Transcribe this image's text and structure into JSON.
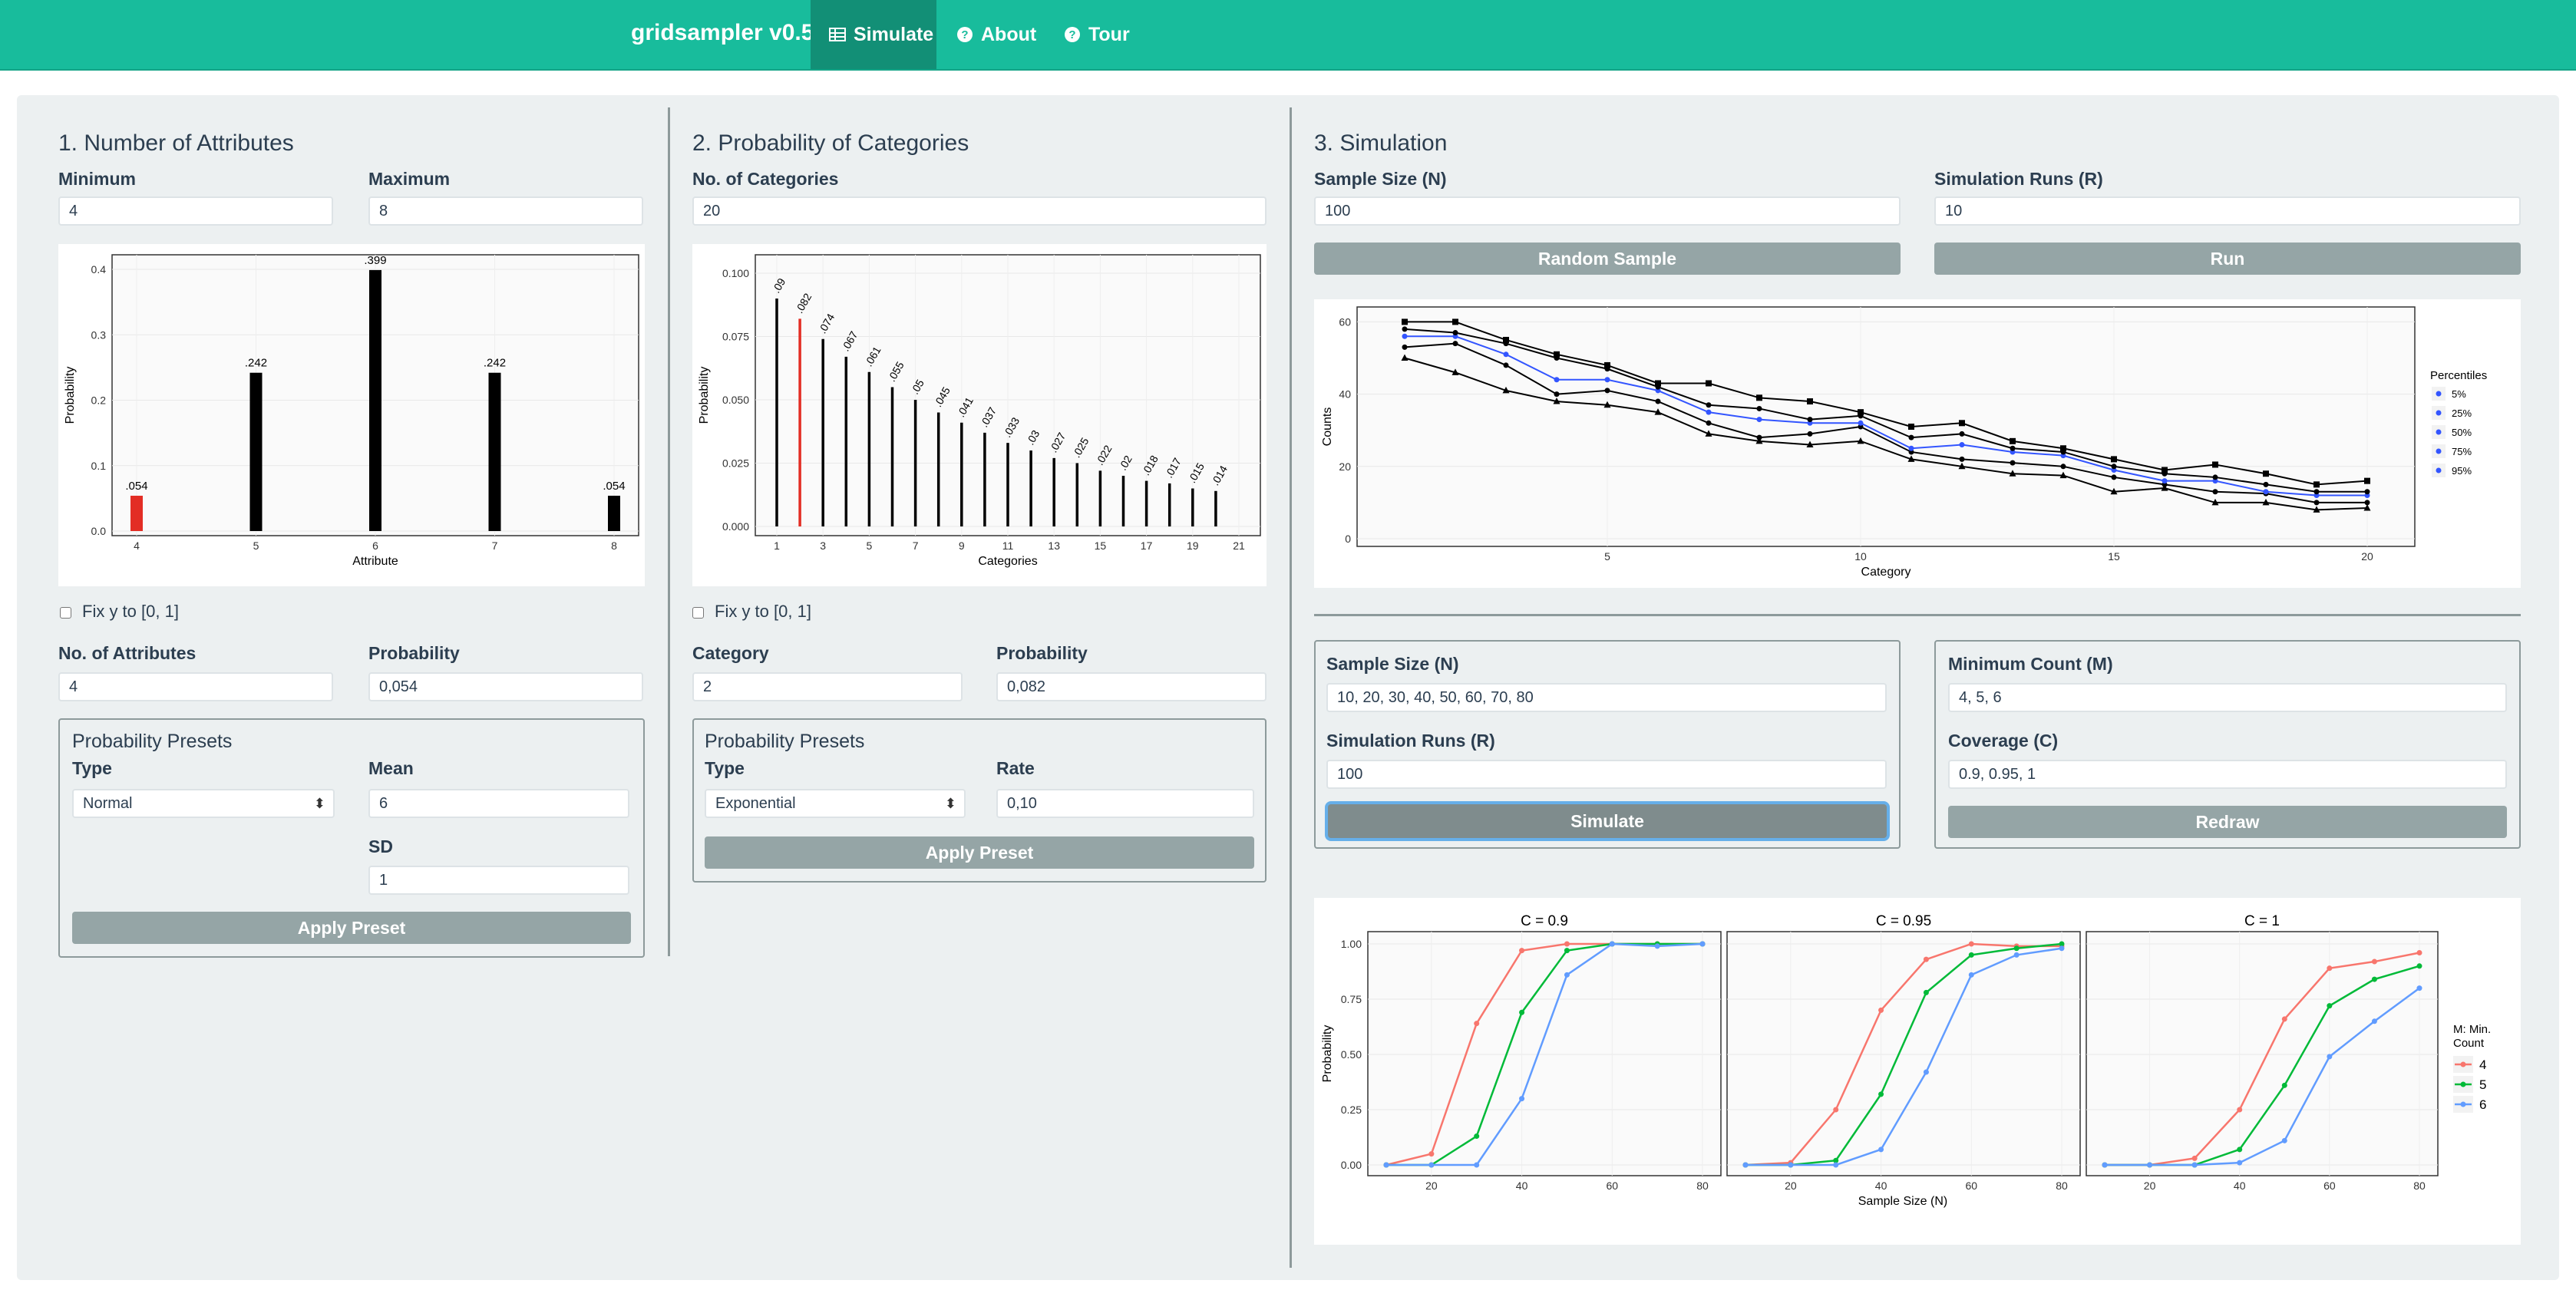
{
  "app": {
    "brand": "gridsampler v0.5",
    "nav": [
      {
        "label": "Simulate",
        "icon": "table-icon",
        "active": true
      },
      {
        "label": "About",
        "icon": "question-circle-icon"
      },
      {
        "label": "Tour",
        "icon": "question-circle-icon"
      }
    ]
  },
  "attributes": {
    "heading": "1. Number of Attributes",
    "min_label": "Minimum",
    "min_value": "4",
    "max_label": "Maximum",
    "max_value": "8",
    "fix_label": "Fix y to [0, 1]",
    "n_label": "No. of Attributes",
    "n_value": "4",
    "p_label": "Probability",
    "p_value": "0,054",
    "presets": {
      "title": "Probability Presets",
      "type_label": "Type",
      "type_value": "Normal",
      "mean_label": "Mean",
      "mean_value": "6",
      "sd_label": "SD",
      "sd_value": "1",
      "apply_label": "Apply Preset"
    }
  },
  "categories": {
    "heading": "2. Probability of Categories",
    "n_label": "No. of Categories",
    "n_value": "20",
    "fix_label": "Fix y to [0, 1]",
    "cat_label": "Category",
    "cat_value": "2",
    "p_label": "Probability",
    "p_value": "0,082",
    "presets": {
      "title": "Probability Presets",
      "type_label": "Type",
      "type_value": "Exponential",
      "rate_label": "Rate",
      "rate_value": "0,10",
      "apply_label": "Apply Preset"
    }
  },
  "simulation": {
    "heading": "3. Simulation",
    "n_label": "Sample Size (N)",
    "n_value": "100",
    "r_label": "Simulation Runs (R)",
    "r_value": "10",
    "random_label": "Random Sample",
    "run_label": "Run",
    "grid": {
      "n_label": "Sample Size (N)",
      "n_value": "10, 20, 30, 40, 50, 60, 70, 80",
      "r_label": "Simulation Runs (R)",
      "r_value": "100",
      "simulate_label": "Simulate",
      "m_label": "Minimum Count (M)",
      "m_value": "4, 5, 6",
      "c_label": "Coverage (C)",
      "c_value": "0.9, 0.95, 1",
      "redraw_label": "Redraw"
    }
  },
  "colors": {
    "navbar": "#18bc9c",
    "highlight_bar": "#e32d24",
    "bar": "#000000",
    "m4": "#f8766d",
    "m5": "#00ba38",
    "m6": "#619cff",
    "median_line": "#3355ff"
  },
  "chart_data": [
    {
      "type": "bar",
      "xlabel": "Attribute",
      "ylabel": "Probability",
      "categories": [
        "4",
        "5",
        "6",
        "7",
        "8"
      ],
      "values": [
        0.054,
        0.242,
        0.399,
        0.242,
        0.054
      ],
      "data_labels": [
        ".054",
        ".242",
        ".399",
        ".242",
        ".054"
      ],
      "highlight_index": 0,
      "ylim": [
        0,
        0.42
      ],
      "yticks": [
        "0.0",
        "0.1",
        "0.2",
        "0.3",
        "0.4"
      ]
    },
    {
      "type": "bar",
      "xlabel": "Categories",
      "ylabel": "Probability",
      "categories": [
        "1",
        "2",
        "3",
        "4",
        "5",
        "6",
        "7",
        "8",
        "9",
        "10",
        "11",
        "12",
        "13",
        "14",
        "15",
        "16",
        "17",
        "18",
        "19",
        "20"
      ],
      "values": [
        0.09,
        0.082,
        0.074,
        0.067,
        0.061,
        0.055,
        0.05,
        0.045,
        0.041,
        0.037,
        0.033,
        0.03,
        0.027,
        0.025,
        0.022,
        0.02,
        0.018,
        0.017,
        0.015,
        0.014
      ],
      "data_labels": [
        ".09",
        ".082",
        ".074",
        ".067",
        ".061",
        ".055",
        ".05",
        ".045",
        ".041",
        ".037",
        ".033",
        ".03",
        ".027",
        ".025",
        ".022",
        ".02",
        ".018",
        ".017",
        ".015",
        ".014"
      ],
      "highlight_index": 1,
      "xticks": [
        "1",
        "3",
        "5",
        "7",
        "9",
        "11",
        "13",
        "15",
        "17",
        "19",
        "21"
      ],
      "yticks": [
        "0.000",
        "0.025",
        "0.050",
        "0.075",
        "0.100"
      ],
      "ylim": [
        0,
        0.1
      ]
    },
    {
      "type": "line",
      "xlabel": "Category",
      "ylabel": "Counts",
      "legend_title": "Percentiles",
      "x": [
        1,
        2,
        3,
        4,
        5,
        6,
        7,
        8,
        9,
        10,
        11,
        12,
        13,
        14,
        15,
        16,
        17,
        18,
        19,
        20
      ],
      "xticks": [
        "5",
        "10",
        "15",
        "20"
      ],
      "yticks": [
        "0",
        "20",
        "40",
        "60"
      ],
      "ylim": [
        0,
        62
      ],
      "series": [
        {
          "name": "5%",
          "values": [
            50,
            46,
            41,
            38,
            37,
            35,
            29,
            27,
            26,
            27,
            22,
            20,
            18,
            17.5,
            13,
            14,
            10,
            10,
            8,
            8.5
          ]
        },
        {
          "name": "25%",
          "values": [
            53,
            54,
            48,
            40,
            41,
            38,
            32,
            28,
            29,
            31,
            24,
            22,
            21,
            20,
            17,
            15,
            13,
            12.5,
            10,
            10
          ]
        },
        {
          "name": "50%",
          "values": [
            56,
            56,
            51,
            44,
            44,
            41,
            35,
            33,
            32,
            32,
            25,
            26,
            24,
            23,
            19,
            16,
            16,
            13,
            12,
            12
          ]
        },
        {
          "name": "75%",
          "values": [
            58,
            57,
            54,
            50,
            47,
            42,
            37,
            36,
            33,
            34,
            28,
            29,
            25,
            24,
            20,
            18,
            17,
            15,
            13,
            13
          ]
        },
        {
          "name": "95%",
          "values": [
            60,
            60,
            55,
            51,
            48,
            43,
            43,
            39,
            38,
            35,
            31,
            32,
            27,
            25,
            22,
            19,
            20.5,
            18,
            15,
            16
          ]
        }
      ]
    },
    {
      "type": "line",
      "xlabel": "Sample Size (N)",
      "ylabel": "Probability",
      "legend_title": "M: Min.\nCount",
      "x": [
        10,
        20,
        30,
        40,
        50,
        60,
        70,
        80
      ],
      "xticks": [
        "20",
        "40",
        "60",
        "80"
      ],
      "yticks": [
        "0.00",
        "0.25",
        "0.50",
        "0.75",
        "1.00"
      ],
      "ylim": [
        0,
        1
      ],
      "panels": [
        {
          "title": "C = 0.9",
          "series": [
            {
              "name": "4",
              "values": [
                0.0,
                0.05,
                0.64,
                0.97,
                1.0,
                1.0,
                1.0,
                1.0
              ]
            },
            {
              "name": "5",
              "values": [
                0.0,
                0.0,
                0.13,
                0.69,
                0.97,
                1.0,
                1.0,
                1.0
              ]
            },
            {
              "name": "6",
              "values": [
                0.0,
                0.0,
                0.0,
                0.3,
                0.86,
                1.0,
                0.99,
                1.0
              ]
            }
          ]
        },
        {
          "title": "C = 0.95",
          "series": [
            {
              "name": "4",
              "values": [
                0.0,
                0.01,
                0.25,
                0.7,
                0.93,
                1.0,
                0.99,
                0.99
              ]
            },
            {
              "name": "5",
              "values": [
                0.0,
                0.0,
                0.02,
                0.32,
                0.78,
                0.95,
                0.98,
                1.0
              ]
            },
            {
              "name": "6",
              "values": [
                0.0,
                0.0,
                0.0,
                0.07,
                0.42,
                0.86,
                0.95,
                0.98
              ]
            }
          ]
        },
        {
          "title": "C = 1",
          "series": [
            {
              "name": "4",
              "values": [
                0.0,
                0.0,
                0.03,
                0.25,
                0.66,
                0.89,
                0.92,
                0.96
              ]
            },
            {
              "name": "5",
              "values": [
                0.0,
                0.0,
                0.0,
                0.07,
                0.36,
                0.72,
                0.84,
                0.9
              ]
            },
            {
              "name": "6",
              "values": [
                0.0,
                0.0,
                0.0,
                0.01,
                0.11,
                0.49,
                0.65,
                0.8
              ]
            }
          ]
        }
      ]
    }
  ]
}
